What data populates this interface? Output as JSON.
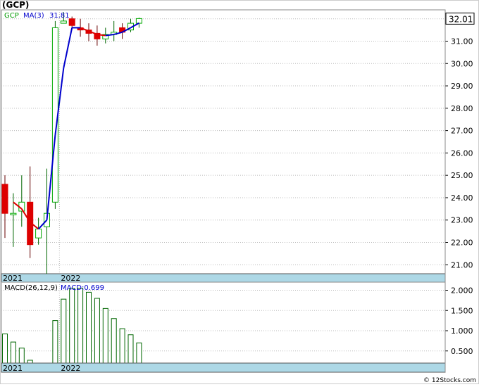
{
  "header": {
    "title": "(GCP)"
  },
  "footer": {
    "credit": "© 12Stocks.com"
  },
  "chart_data": [
    {
      "type": "candlestick",
      "legend": {
        "ticker": "GCP",
        "ma_label": "MA(3)",
        "ma_value": "31.81"
      },
      "last_price": "32.01",
      "ylim": [
        20.6,
        32.4
      ],
      "ytick_labels": [
        "21.00",
        "22.00",
        "23.00",
        "24.00",
        "25.00",
        "26.00",
        "27.00",
        "28.00",
        "29.00",
        "30.00",
        "31.00",
        "32.00"
      ],
      "ytick_values": [
        21,
        22,
        23,
        24,
        25,
        26,
        27,
        28,
        29,
        30,
        31,
        32
      ],
      "year_labels": [
        {
          "label": "2021",
          "index": 0
        },
        {
          "label": "2022",
          "index": 7
        }
      ],
      "colors": {
        "up": "#00aa00",
        "down": "#dd0000",
        "ma_up": "#0000cc",
        "ma_down": "#dd0000",
        "date_band": "#add8e6"
      },
      "candles": [
        {
          "o": 24.6,
          "h": 25.0,
          "l": 22.2,
          "c": 23.3
        },
        {
          "o": 23.3,
          "h": 24.2,
          "l": 21.8,
          "c": 23.3
        },
        {
          "o": 23.4,
          "h": 25.0,
          "l": 22.7,
          "c": 23.8
        },
        {
          "o": 23.8,
          "h": 25.4,
          "l": 21.3,
          "c": 21.9
        },
        {
          "o": 22.2,
          "h": 23.1,
          "l": 21.9,
          "c": 22.6
        },
        {
          "o": 22.7,
          "h": 25.3,
          "l": 20.6,
          "c": 23.3
        },
        {
          "o": 23.8,
          "h": 31.9,
          "l": 23.5,
          "c": 31.6
        },
        {
          "o": 31.8,
          "h": 32.3,
          "l": 31.8,
          "c": 31.9
        },
        {
          "o": 32.0,
          "h": 32.1,
          "l": 31.5,
          "c": 31.7
        },
        {
          "o": 31.6,
          "h": 32.0,
          "l": 31.2,
          "c": 31.5
        },
        {
          "o": 31.5,
          "h": 31.8,
          "l": 31.0,
          "c": 31.35
        },
        {
          "o": 31.35,
          "h": 31.7,
          "l": 30.8,
          "c": 31.1
        },
        {
          "o": 31.1,
          "h": 31.6,
          "l": 30.9,
          "c": 31.3
        },
        {
          "o": 31.3,
          "h": 31.9,
          "l": 31.0,
          "c": 31.4
        },
        {
          "o": 31.6,
          "h": 31.8,
          "l": 31.1,
          "c": 31.4
        },
        {
          "o": 31.5,
          "h": 32.0,
          "l": 31.4,
          "c": 31.8
        },
        {
          "o": 31.8,
          "h": 32.05,
          "l": 31.6,
          "c": 32.01
        }
      ],
      "ma": [
        null,
        23.8,
        23.5,
        22.9,
        22.6,
        23.0,
        26.8,
        29.8,
        31.6,
        31.6,
        31.45,
        31.3,
        31.25,
        31.3,
        31.4,
        31.6,
        31.81
      ]
    },
    {
      "type": "bar",
      "legend": {
        "label": "MACD(26,12,9)",
        "value_label": "MACD:0.699"
      },
      "ylim": [
        0.2,
        2.2
      ],
      "ytick_labels": [
        "0.500",
        "1.000",
        "1.500",
        "2.000"
      ],
      "ytick_values": [
        0.5,
        1.0,
        1.5,
        2.0
      ],
      "year_labels": [
        {
          "label": "2021",
          "index": 0
        },
        {
          "label": "2022",
          "index": 7
        }
      ],
      "colors": {
        "bar": "#006600",
        "date_band": "#add8e6"
      },
      "values": [
        0.92,
        0.72,
        0.57,
        0.27,
        0.0,
        0.0,
        1.25,
        1.78,
        2.05,
        2.05,
        1.95,
        1.8,
        1.55,
        1.3,
        1.05,
        0.9,
        0.699
      ]
    }
  ]
}
